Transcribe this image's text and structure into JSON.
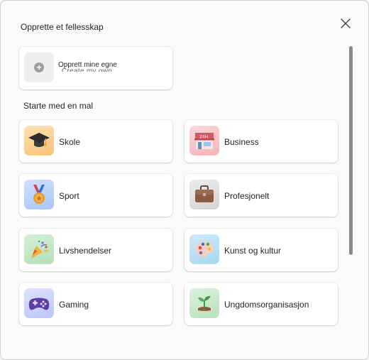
{
  "dialog": {
    "title": "Opprette et fellesskap",
    "close_icon": "close-icon"
  },
  "create": {
    "label": "Opprett mine egne",
    "ghost_label": "Create my own",
    "icon": "plus-circle-icon"
  },
  "templates": {
    "section_label": "Starte med en mal",
    "items": [
      {
        "label": "Skole",
        "icon": "graduation-cap-icon",
        "color": "#fbd39b"
      },
      {
        "label": "Business",
        "icon": "storefront-icon",
        "color": "#f7c5c9"
      },
      {
        "label": "Sport",
        "icon": "medal-icon",
        "color": "#b9d3fb"
      },
      {
        "label": "Profesjonelt",
        "icon": "briefcase-icon",
        "color": "#e1dfdd"
      },
      {
        "label": "Livshendelser",
        "icon": "party-popper-icon",
        "color": "#bfe7c3"
      },
      {
        "label": "Kunst og kultur",
        "icon": "palette-icon",
        "color": "#b7e0f5"
      },
      {
        "label": "Gaming",
        "icon": "game-controller-icon",
        "color": "#cdd3fb"
      },
      {
        "label": "Ungdomsorganisasjon",
        "icon": "seedling-icon",
        "color": "#c9eacb"
      }
    ]
  }
}
